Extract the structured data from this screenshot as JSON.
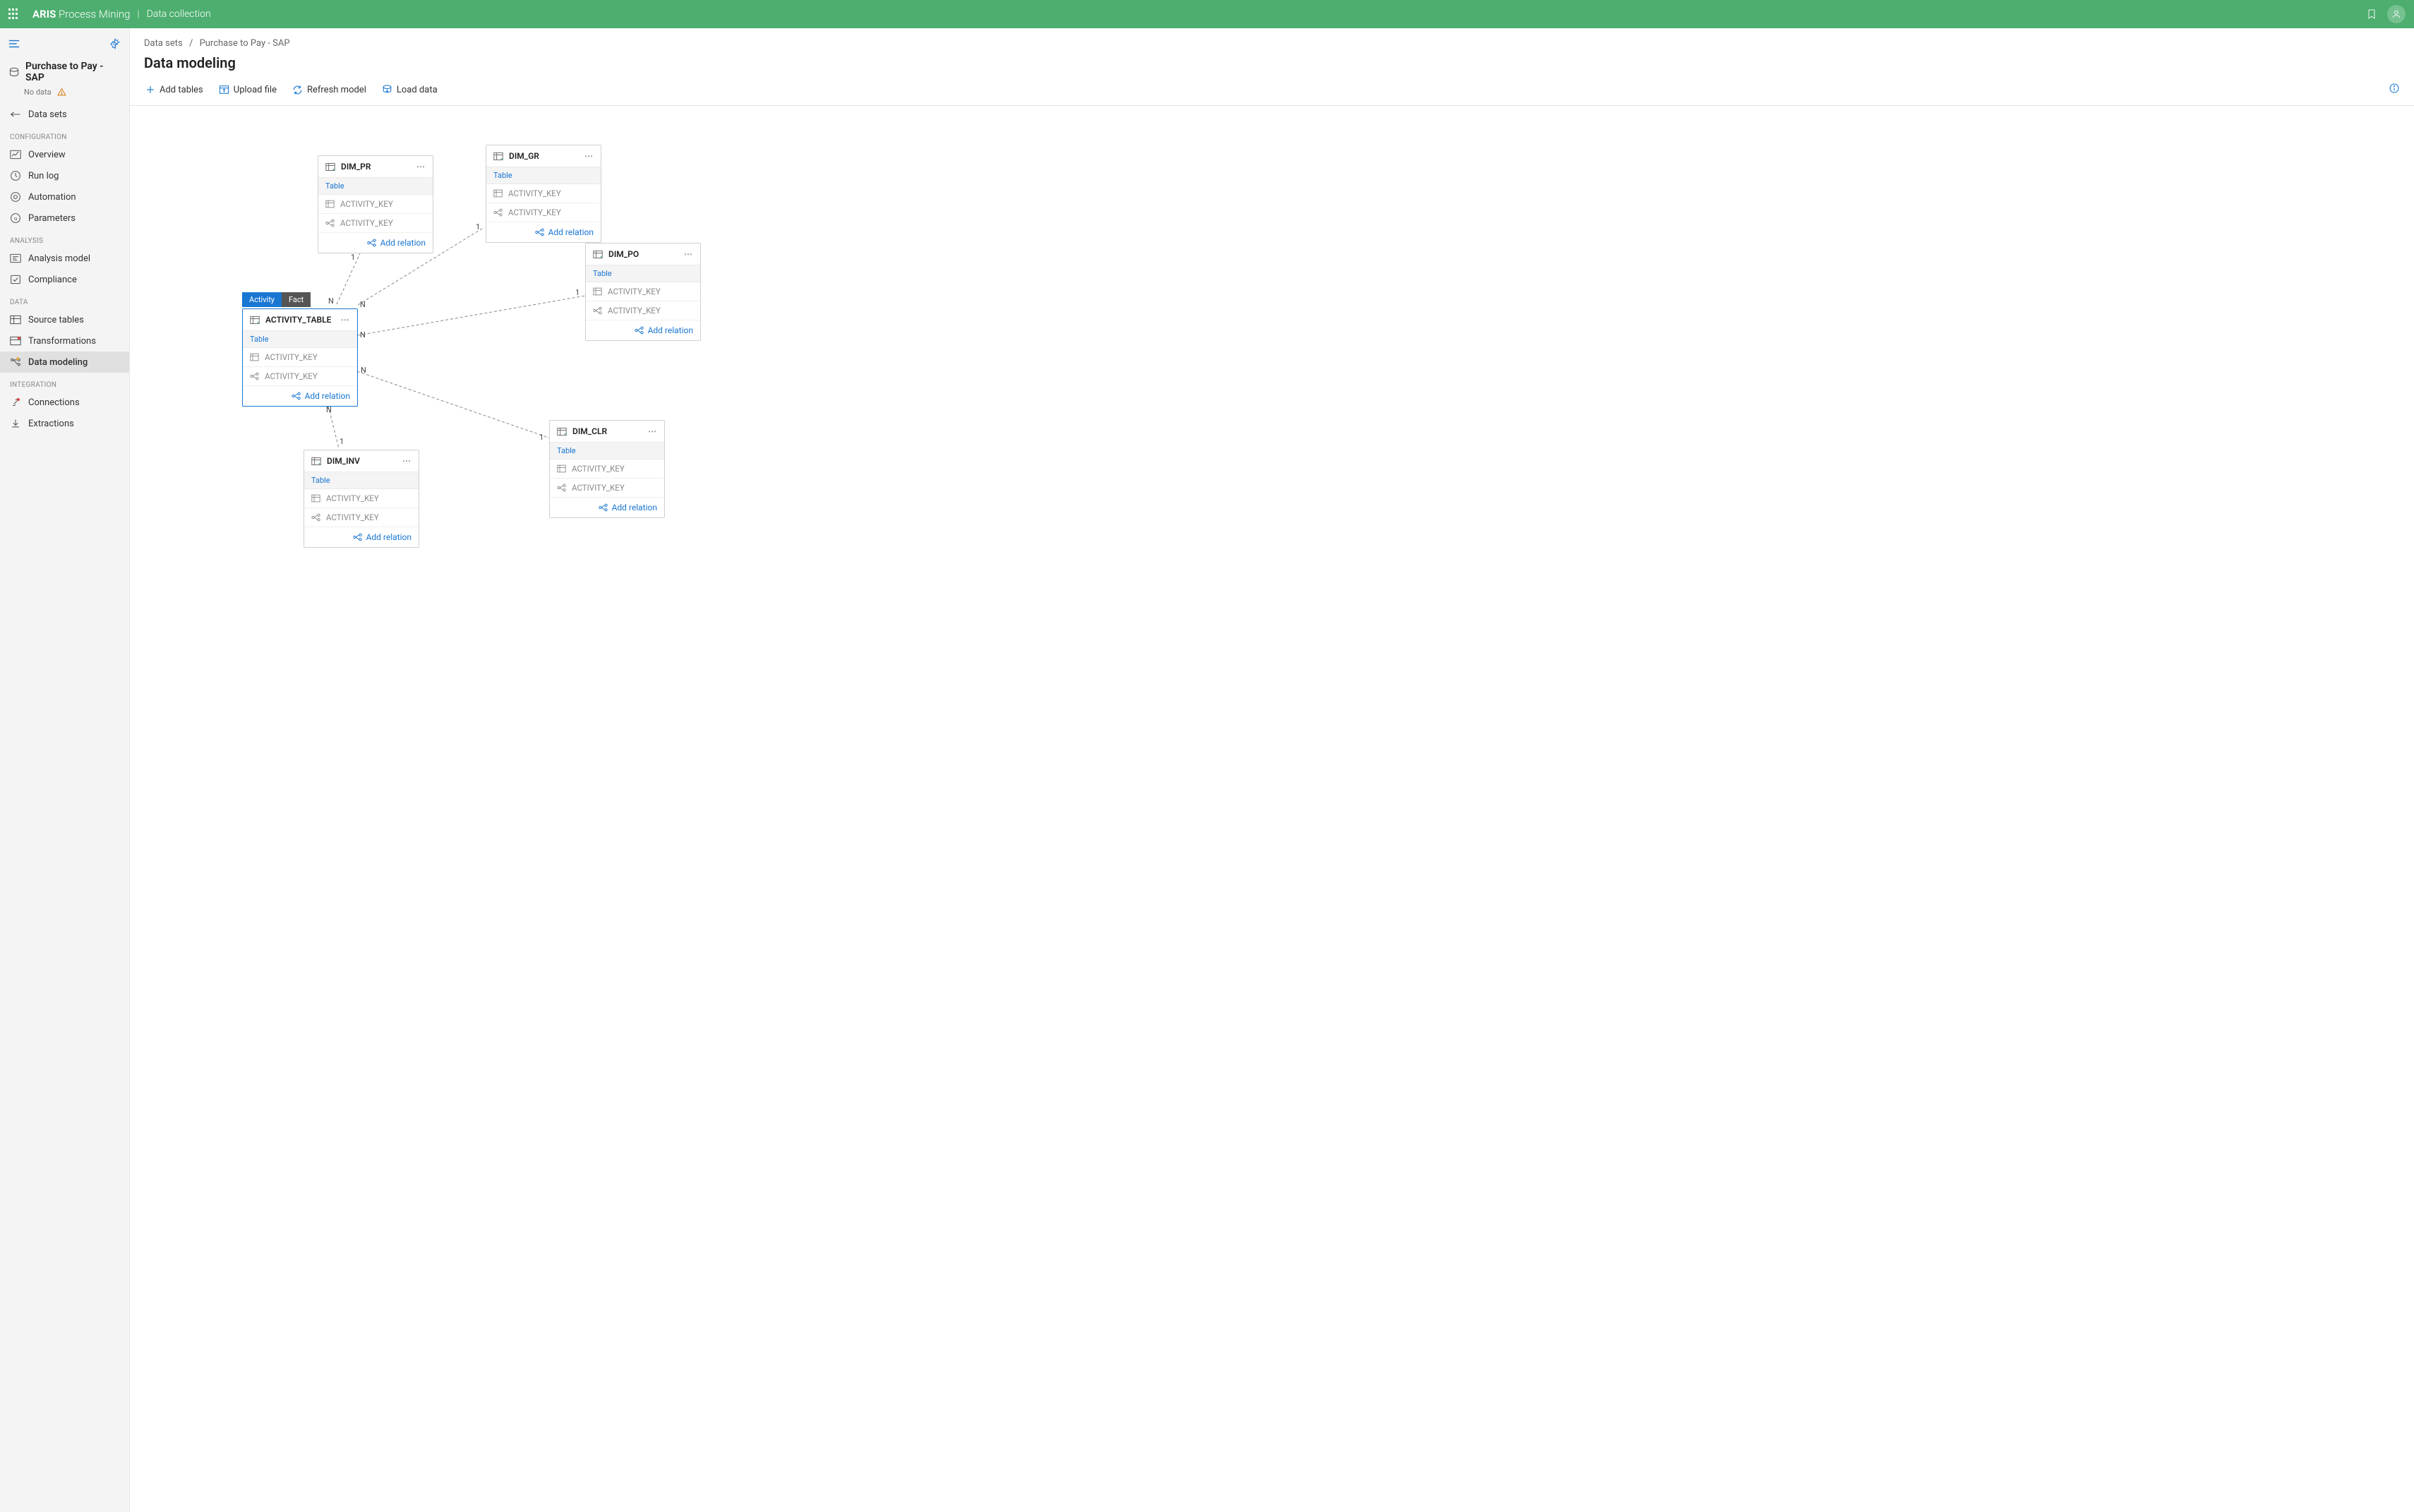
{
  "header": {
    "brand_bold": "ARIS",
    "brand_rest": "Process Mining",
    "module": "Data collection"
  },
  "sidebar": {
    "dataset_name": "Purchase to Pay - SAP",
    "dataset_status": "No data",
    "back_label": "Data sets",
    "sections": {
      "configuration": "CONFIGURATION",
      "analysis": "ANALYSIS",
      "data": "DATA",
      "integration": "INTEGRATION"
    },
    "items": {
      "overview": "Overview",
      "run_log": "Run log",
      "automation": "Automation",
      "parameters": "Parameters",
      "analysis_model": "Analysis model",
      "compliance": "Compliance",
      "source_tables": "Source tables",
      "transformations": "Transformations",
      "data_modeling": "Data modeling",
      "connections": "Connections",
      "extractions": "Extractions"
    }
  },
  "breadcrumb": {
    "root": "Data sets",
    "current": "Purchase to Pay - SAP"
  },
  "page_title": "Data modeling",
  "toolbar": {
    "add_tables": "Add tables",
    "upload_file": "Upload file",
    "refresh_model": "Refresh model",
    "load_data": "Load data"
  },
  "nodes": {
    "activity_table": {
      "title": "ACTIVITY_TABLE",
      "badge_activity": "Activity",
      "badge_fact": "Fact",
      "sub": "Table",
      "row1": "ACTIVITY_KEY",
      "row2": "ACTIVITY_KEY",
      "add_relation": "Add relation"
    },
    "dim_pr": {
      "title": "DIM_PR",
      "sub": "Table",
      "row1": "ACTIVITY_KEY",
      "row2": "ACTIVITY_KEY",
      "add_relation": "Add relation"
    },
    "dim_gr": {
      "title": "DIM_GR",
      "sub": "Table",
      "row1": "ACTIVITY_KEY",
      "row2": "ACTIVITY_KEY",
      "add_relation": "Add relation"
    },
    "dim_po": {
      "title": "DIM_PO",
      "sub": "Table",
      "row1": "ACTIVITY_KEY",
      "row2": "ACTIVITY_KEY",
      "add_relation": "Add relation"
    },
    "dim_inv": {
      "title": "DIM_INV",
      "sub": "Table",
      "row1": "ACTIVITY_KEY",
      "row2": "ACTIVITY_KEY",
      "add_relation": "Add relation"
    },
    "dim_clr": {
      "title": "DIM_CLR",
      "sub": "Table",
      "row1": "ACTIVITY_KEY",
      "row2": "ACTIVITY_KEY",
      "add_relation": "Add relation"
    }
  },
  "cardinality": {
    "n": "N",
    "one": "1"
  }
}
